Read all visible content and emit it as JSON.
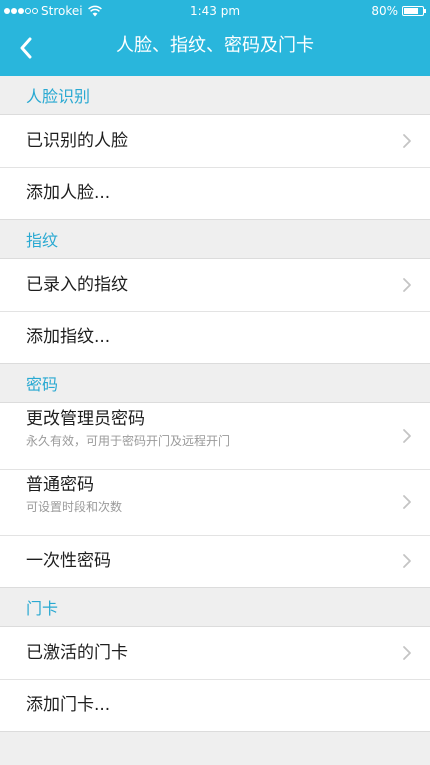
{
  "status_bar": {
    "carrier": "Strokei",
    "time": "1:43 pm",
    "battery": "80%",
    "battery_level": 0.8
  },
  "nav": {
    "title": "人脸、指纹、密码及门卡",
    "back_icon": "chevron-left-icon"
  },
  "sections": {
    "face": {
      "header": "人脸识别",
      "items": [
        {
          "title": "已识别的人脸",
          "chevron": true
        },
        {
          "title": "添加人脸...",
          "chevron": false
        }
      ]
    },
    "fingerprint": {
      "header": "指纹",
      "items": [
        {
          "title": "已录入的指纹",
          "chevron": true
        },
        {
          "title": "添加指纹...",
          "chevron": false
        }
      ]
    },
    "password": {
      "header": "密码",
      "items": [
        {
          "title": "更改管理员密码",
          "subtitle": "永久有效，可用于密码开门及远程开门",
          "chevron": true
        },
        {
          "title": "普通密码",
          "subtitle": "可设置时段和次数",
          "chevron": true
        },
        {
          "title": "一次性密码",
          "chevron": true
        }
      ]
    },
    "card": {
      "header": "门卡",
      "items": [
        {
          "title": "已激活的门卡",
          "chevron": true
        },
        {
          "title": "添加门卡...",
          "chevron": false
        }
      ]
    }
  },
  "colors": {
    "accent": "#29b6dc",
    "section_header": "#29a9d2",
    "background": "#efefef",
    "subtitle": "#9a9a9a"
  }
}
